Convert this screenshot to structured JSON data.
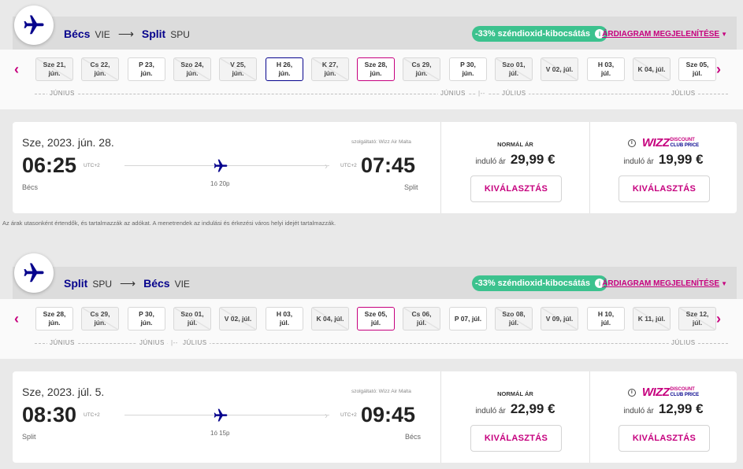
{
  "outbound": {
    "route": {
      "from_city": "Bécs",
      "from_code": "VIE",
      "arrow": "⟶",
      "to_city": "Split",
      "to_code": "SPU"
    },
    "co2_badge": "-33% széndioxid-kibocsátás",
    "diagram_link": "ÁRDIAGRAM MEGJELENÍTÉSE",
    "dates": [
      {
        "l1": "Sze 21,",
        "l2": "jún.",
        "state": "disabled"
      },
      {
        "l1": "Cs 22,",
        "l2": "jún.",
        "state": "disabled"
      },
      {
        "l1": "P 23,",
        "l2": "jún.",
        "state": "enabled"
      },
      {
        "l1": "Szo 24,",
        "l2": "jún.",
        "state": "disabled"
      },
      {
        "l1": "V 25,",
        "l2": "jún.",
        "state": "disabled"
      },
      {
        "l1": "H 26,",
        "l2": "jún.",
        "state": "selected-other"
      },
      {
        "l1": "K 27,",
        "l2": "jún.",
        "state": "disabled"
      },
      {
        "l1": "Sze 28,",
        "l2": "jún.",
        "state": "selected"
      },
      {
        "l1": "Cs 29,",
        "l2": "jún.",
        "state": "disabled"
      },
      {
        "l1": "P 30,",
        "l2": "jún.",
        "state": "enabled"
      },
      {
        "l1": "Szo 01,",
        "l2": "júl.",
        "state": "disabled"
      },
      {
        "l1": "V 02, júl.",
        "l2": "",
        "state": "disabled"
      },
      {
        "l1": "H 03,",
        "l2": "júl.",
        "state": "enabled"
      },
      {
        "l1": "K 04, júl.",
        "l2": "",
        "state": "disabled"
      },
      {
        "l1": "Sze 05,",
        "l2": "júl.",
        "state": "enabled"
      }
    ],
    "months": {
      "m1": "JÚNIUS",
      "m2": "JÚNIUS",
      "m3": "JÚLIUS",
      "m4": "JÚLIUS"
    },
    "flight": {
      "date": "Sze, 2023. jún. 28.",
      "carrier": "szolgáltató: Wizz Air Malta",
      "dep_time": "06:25",
      "dep_utc": "UTC+2",
      "dep_city": "Bécs",
      "arr_time": "07:45",
      "arr_utc": "UTC+2",
      "arr_city": "Split",
      "duration": "1ó 20p"
    },
    "fares": {
      "normal_title": "NORMÁL ÁR",
      "normal_from": "induló ár",
      "normal_price": "29,99 €",
      "club_logo": "WIZZ",
      "club_sub1": "DISCOUNT",
      "club_sub2": "CLUB PRICE",
      "club_from": "induló ár",
      "club_price": "19,99 €",
      "select_label": "KIVÁLASZTÁS"
    }
  },
  "disclaimer": "Az árak utasonként értendők, és tartalmazzák az adókat. A menetrendek az indulási és érkezési város helyi idejét tartalmazzák.",
  "inbound": {
    "route": {
      "from_city": "Split",
      "from_code": "SPU",
      "arrow": "⟶",
      "to_city": "Bécs",
      "to_code": "VIE"
    },
    "co2_badge": "-33% széndioxid-kibocsátás",
    "diagram_link": "ÁRDIAGRAM MEGJELENÍTÉSE",
    "dates": [
      {
        "l1": "Sze 28,",
        "l2": "jún.",
        "state": "enabled"
      },
      {
        "l1": "Cs 29,",
        "l2": "jún.",
        "state": "disabled"
      },
      {
        "l1": "P 30,",
        "l2": "jún.",
        "state": "enabled"
      },
      {
        "l1": "Szo 01,",
        "l2": "júl.",
        "state": "disabled"
      },
      {
        "l1": "V 02, júl.",
        "l2": "",
        "state": "disabled"
      },
      {
        "l1": "H 03,",
        "l2": "júl.",
        "state": "enabled"
      },
      {
        "l1": "K 04, júl.",
        "l2": "",
        "state": "disabled"
      },
      {
        "l1": "Sze 05,",
        "l2": "júl.",
        "state": "selected"
      },
      {
        "l1": "Cs 06,",
        "l2": "júl.",
        "state": "disabled"
      },
      {
        "l1": "P 07, júl.",
        "l2": "",
        "state": "enabled"
      },
      {
        "l1": "Szo 08,",
        "l2": "júl.",
        "state": "disabled"
      },
      {
        "l1": "V 09, júl.",
        "l2": "",
        "state": "disabled"
      },
      {
        "l1": "H 10,",
        "l2": "júl.",
        "state": "enabled"
      },
      {
        "l1": "K 11, júl.",
        "l2": "",
        "state": "disabled"
      },
      {
        "l1": "Sze 12,",
        "l2": "júl.",
        "state": "disabled"
      }
    ],
    "months": {
      "m1": "JÚNIUS",
      "m2": "JÚNIUS",
      "m3": "JÚLIUS",
      "m4": "JÚLIUS"
    },
    "flight": {
      "date": "Sze, 2023. júl. 5.",
      "carrier": "szolgáltató: Wizz Air Malta",
      "dep_time": "08:30",
      "dep_utc": "UTC+2",
      "dep_city": "Split",
      "arr_time": "09:45",
      "arr_utc": "UTC+2",
      "arr_city": "Bécs",
      "duration": "1ó 15p"
    },
    "fares": {
      "normal_title": "NORMÁL ÁR",
      "normal_from": "induló ár",
      "normal_price": "22,99 €",
      "club_logo": "WIZZ",
      "club_sub1": "DISCOUNT",
      "club_sub2": "CLUB PRICE",
      "club_from": "induló ár",
      "club_price": "12,99 €",
      "select_label": "KIVÁLASZTÁS"
    }
  },
  "icons": {
    "nav_prev": "chevron-left-icon",
    "nav_next": "chevron-right-icon",
    "plane": "airplane-icon",
    "info": "info-icon"
  },
  "colors": {
    "brand_magenta": "#c6007e",
    "brand_navy": "#06038d",
    "co2_green": "#3cc28e"
  }
}
